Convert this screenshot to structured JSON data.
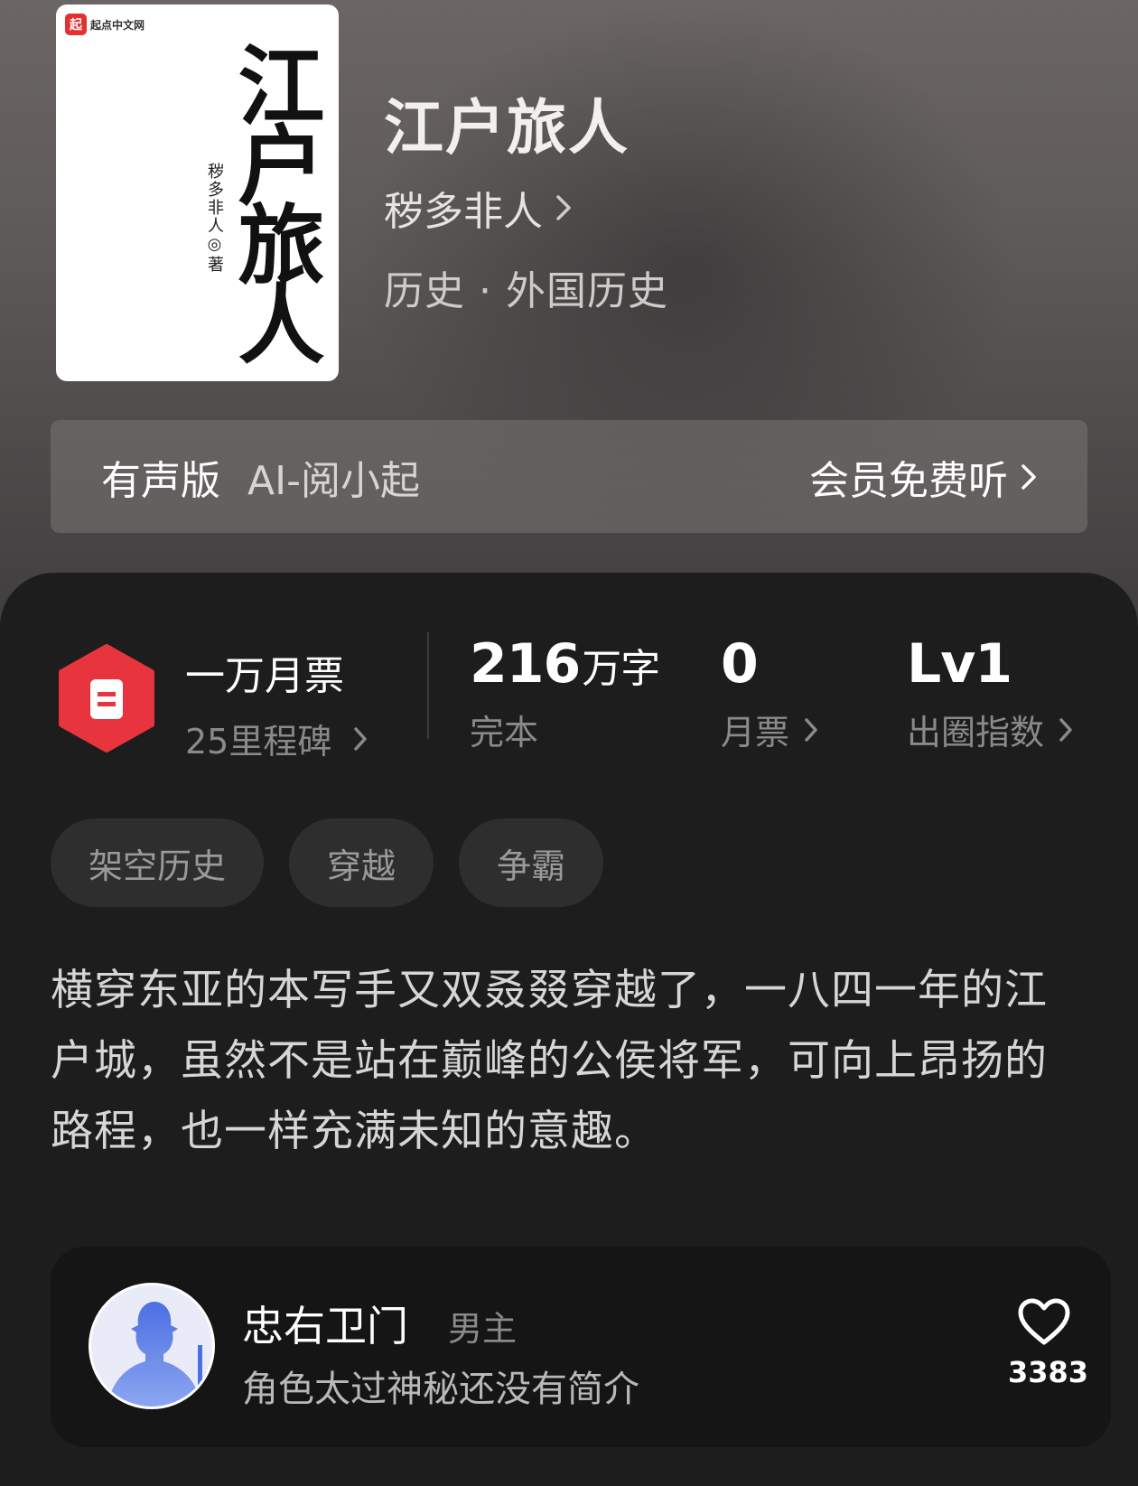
{
  "book": {
    "title": "江户旅人",
    "author": "秽多非人",
    "category": "历史 · 外国历史"
  },
  "cover": {
    "brand_logo": "起",
    "brand_name": "起点中文网",
    "calligraphy": "江户旅人",
    "byline": "秽多非人◎著"
  },
  "audio": {
    "label": "有声版",
    "ai_label": "AI-阅小起",
    "action": "会员免费听"
  },
  "stats": {
    "monthly_title": "一万月票",
    "milestones": "25里程碑",
    "word_count": "216",
    "word_unit": "万字",
    "status": "完本",
    "monthly_tickets": "0",
    "monthly_tickets_label": "月票",
    "level": "Lv1",
    "level_label": "出圈指数"
  },
  "tags": [
    "架空历史",
    "穿越",
    "争霸"
  ],
  "description": "横穿东亚的本写手又双叒叕穿越了，一八四一年的江户城，虽然不是站在巅峰的公侯将军，可向上昂扬的路程，也一样充满未知的意趣。",
  "character": {
    "name": "忠右卫门",
    "role": "男主",
    "intro": "角色太过神秘还没有简介",
    "likes": "3383"
  },
  "colors": {
    "accent_red": "#e8343c",
    "avatar_blue": "#5b7ee8"
  }
}
